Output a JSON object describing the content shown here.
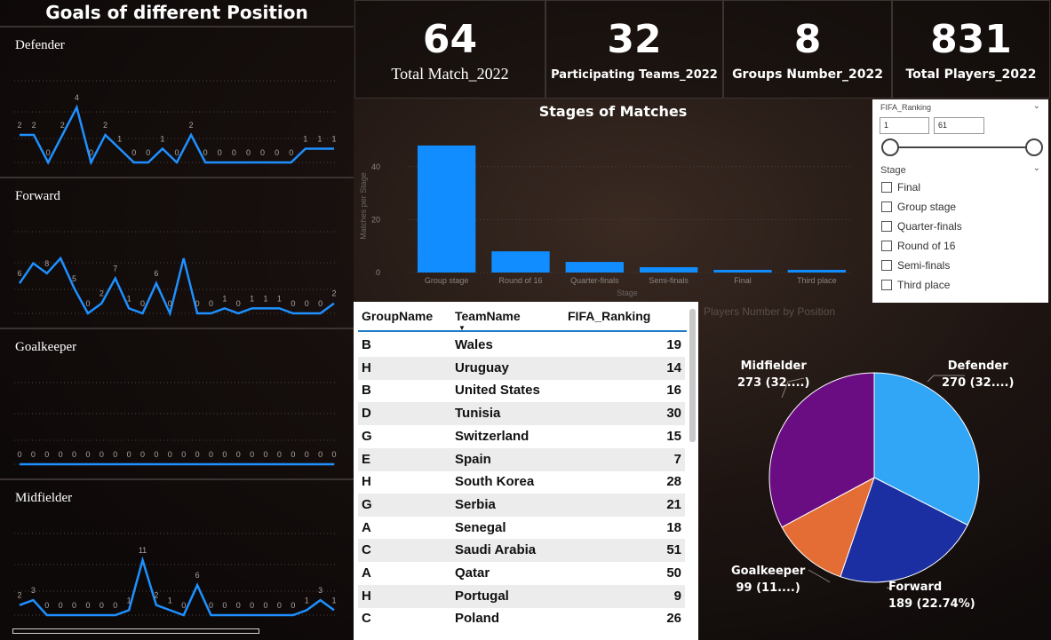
{
  "left_title": "Goals of different Position",
  "positions": [
    {
      "label": "Defender",
      "values": [
        2,
        2,
        0,
        2,
        4,
        0,
        2,
        1,
        0,
        0,
        1,
        0,
        2,
        0,
        0,
        0,
        0,
        0,
        0,
        0,
        1,
        1,
        1
      ],
      "labels_shown": [
        "2",
        "2",
        "0",
        "2",
        "4",
        "0",
        "2",
        "1",
        "0",
        "0",
        "1",
        "0",
        "2",
        "0",
        "0",
        "0",
        "0",
        "0",
        "0",
        "0",
        "1",
        "1",
        "1"
      ]
    },
    {
      "label": "Forward",
      "values": [
        6,
        10,
        8,
        11,
        5,
        0,
        2,
        7,
        1,
        0,
        6,
        0,
        11,
        0,
        0,
        1,
        0,
        1,
        1,
        1,
        0,
        0,
        0,
        2
      ],
      "labels_shown": [
        "6",
        "",
        "8",
        "",
        "5",
        "0",
        "2",
        "7",
        "1",
        "0",
        "6",
        "0",
        "",
        "0",
        "0",
        "1",
        "0",
        "1",
        "1",
        "1",
        "0",
        "0",
        "0",
        "2"
      ]
    },
    {
      "label": "Goalkeeper",
      "values": [
        0,
        0,
        0,
        0,
        0,
        0,
        0,
        0,
        0,
        0,
        0,
        0,
        0,
        0,
        0,
        0,
        0,
        0,
        0,
        0,
        0,
        0,
        0,
        0
      ],
      "labels_shown": [
        "0",
        "0",
        "0",
        "0",
        "0",
        "0",
        "0",
        "0",
        "0",
        "0",
        "0",
        "0",
        "0",
        "0",
        "0",
        "0",
        "0",
        "0",
        "0",
        "0",
        "0",
        "0",
        "0",
        "0"
      ]
    },
    {
      "label": "Midfielder",
      "values": [
        2,
        3,
        0,
        0,
        0,
        0,
        0,
        0,
        1,
        11,
        2,
        1,
        0,
        6,
        0,
        0,
        0,
        0,
        0,
        0,
        0,
        1,
        3,
        1
      ],
      "labels_shown": [
        "2",
        "3",
        "0",
        "0",
        "0",
        "0",
        "0",
        "0",
        "1",
        "11",
        "2",
        "1",
        "0",
        "6",
        "0",
        "0",
        "0",
        "0",
        "0",
        "0",
        "0",
        "1",
        "3",
        "1"
      ]
    }
  ],
  "cards": [
    {
      "value": "64",
      "label": "Total Match_2022"
    },
    {
      "value": "32",
      "label": "Participating Teams_2022"
    },
    {
      "value": "8",
      "label": "Groups Number_2022"
    },
    {
      "value": "831",
      "label": "Total Players_2022"
    }
  ],
  "chart_data": {
    "type": "bar",
    "title": "Stages of Matches",
    "xlabel": "Stage",
    "ylabel": "Matches per Stage",
    "categories": [
      "Group stage",
      "Round of 16",
      "Quarter-finals",
      "Semi-finals",
      "Final",
      "Third place"
    ],
    "values": [
      48,
      8,
      4,
      2,
      1,
      1
    ],
    "ylim": [
      0,
      52
    ],
    "yticks": [
      "0",
      "20",
      "40"
    ],
    "bar_color": "#118dff"
  },
  "slicer": {
    "ranking_title": "FIFA_Ranking",
    "range_min": "1",
    "range_max": "61",
    "stage_title": "Stage",
    "options": [
      "Final",
      "Group stage",
      "Quarter-finals",
      "Round of 16",
      "Semi-finals",
      "Third place"
    ]
  },
  "table": {
    "headers": [
      "GroupName",
      "TeamName",
      "FIFA_Ranking"
    ],
    "rows": [
      [
        "B",
        "Wales",
        "19"
      ],
      [
        "H",
        "Uruguay",
        "14"
      ],
      [
        "B",
        "United States",
        "16"
      ],
      [
        "D",
        "Tunisia",
        "30"
      ],
      [
        "G",
        "Switzerland",
        "15"
      ],
      [
        "E",
        "Spain",
        "7"
      ],
      [
        "H",
        "South Korea",
        "28"
      ],
      [
        "G",
        "Serbia",
        "21"
      ],
      [
        "A",
        "Senegal",
        "18"
      ],
      [
        "C",
        "Saudi Arabia",
        "51"
      ],
      [
        "A",
        "Qatar",
        "50"
      ],
      [
        "H",
        "Portugal",
        "9"
      ],
      [
        "C",
        "Poland",
        "26"
      ]
    ]
  },
  "pie": {
    "title": "Players Number by Position",
    "slices": [
      {
        "name": "Defender",
        "value": 270,
        "label": "270 (32....)",
        "color": "#31a6f7"
      },
      {
        "name": "Forward",
        "value": 189,
        "label": "189 (22.74%)",
        "color": "#1b2fa3"
      },
      {
        "name": "Goalkeeper",
        "value": 99,
        "label": "99 (11....)",
        "color": "#e46c35"
      },
      {
        "name": "Midfielder",
        "value": 273,
        "label": "273 (32....)",
        "color": "#6a0d82"
      }
    ]
  },
  "colors": {
    "line": "#1e90ff",
    "accent": "#1f7ac8"
  }
}
